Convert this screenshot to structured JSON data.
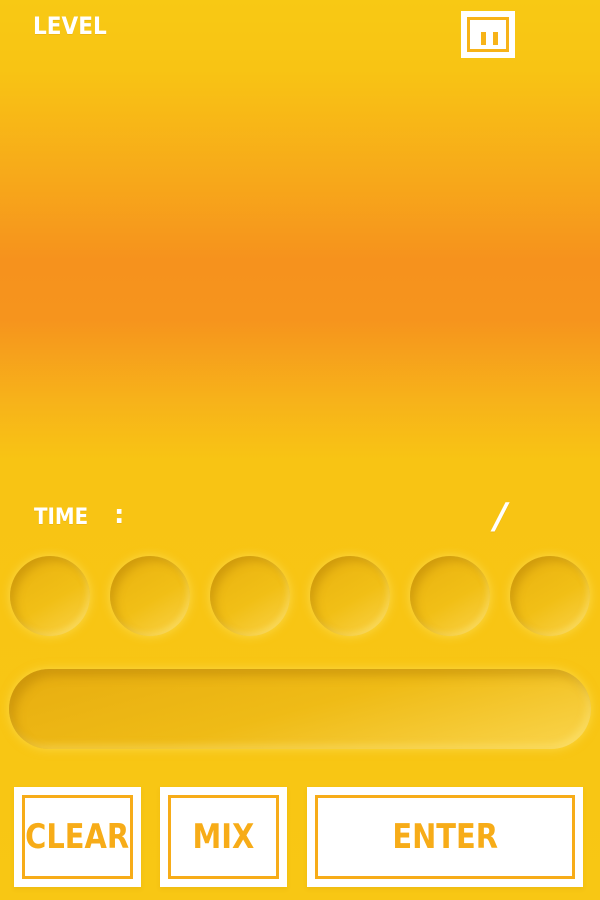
{
  "hud": {
    "level_label": "LEVEL",
    "time_label": "TIME",
    "time_separator": ":",
    "progress_separator": "/",
    "pause_icon": "pause-icon"
  },
  "letter_slots": {
    "count": 6
  },
  "buttons": {
    "clear": "CLEAR",
    "mix": "MIX",
    "enter": "ENTER"
  },
  "colors": {
    "background_top": "#f8c914",
    "background_mid": "#f6921d",
    "accent": "#f7ac18",
    "text": "#ffffff"
  }
}
